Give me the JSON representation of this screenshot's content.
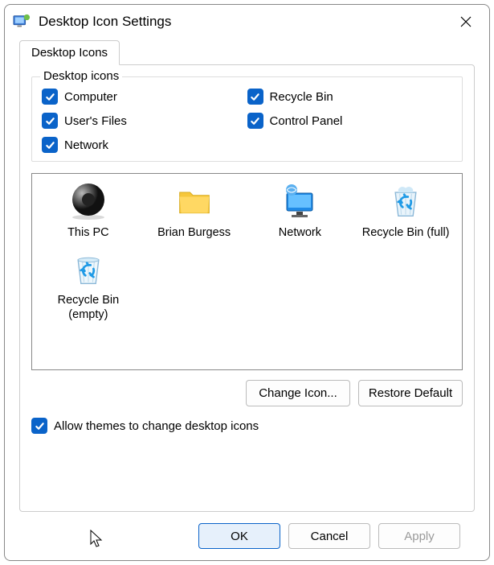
{
  "window": {
    "title": "Desktop Icon Settings"
  },
  "tab": {
    "label": "Desktop Icons"
  },
  "group": {
    "legend": "Desktop icons",
    "checks": {
      "computer": {
        "label": "Computer",
        "checked": true
      },
      "recyclebin": {
        "label": "Recycle Bin",
        "checked": true
      },
      "usersfiles": {
        "label": "User's Files",
        "checked": true
      },
      "controlpanel": {
        "label": "Control Panel",
        "checked": true
      },
      "network": {
        "label": "Network",
        "checked": true
      }
    }
  },
  "icons": {
    "thispc": {
      "label": "This PC"
    },
    "user": {
      "label": "Brian Burgess"
    },
    "network": {
      "label": "Network"
    },
    "rbfull": {
      "label": "Recycle Bin (full)"
    },
    "rbempty": {
      "label": "Recycle Bin (empty)"
    }
  },
  "buttons": {
    "changeicon": "Change Icon...",
    "restore": "Restore Default",
    "ok": "OK",
    "cancel": "Cancel",
    "apply": "Apply"
  },
  "allowthemes": {
    "label": "Allow themes to change desktop icons",
    "checked": true
  }
}
